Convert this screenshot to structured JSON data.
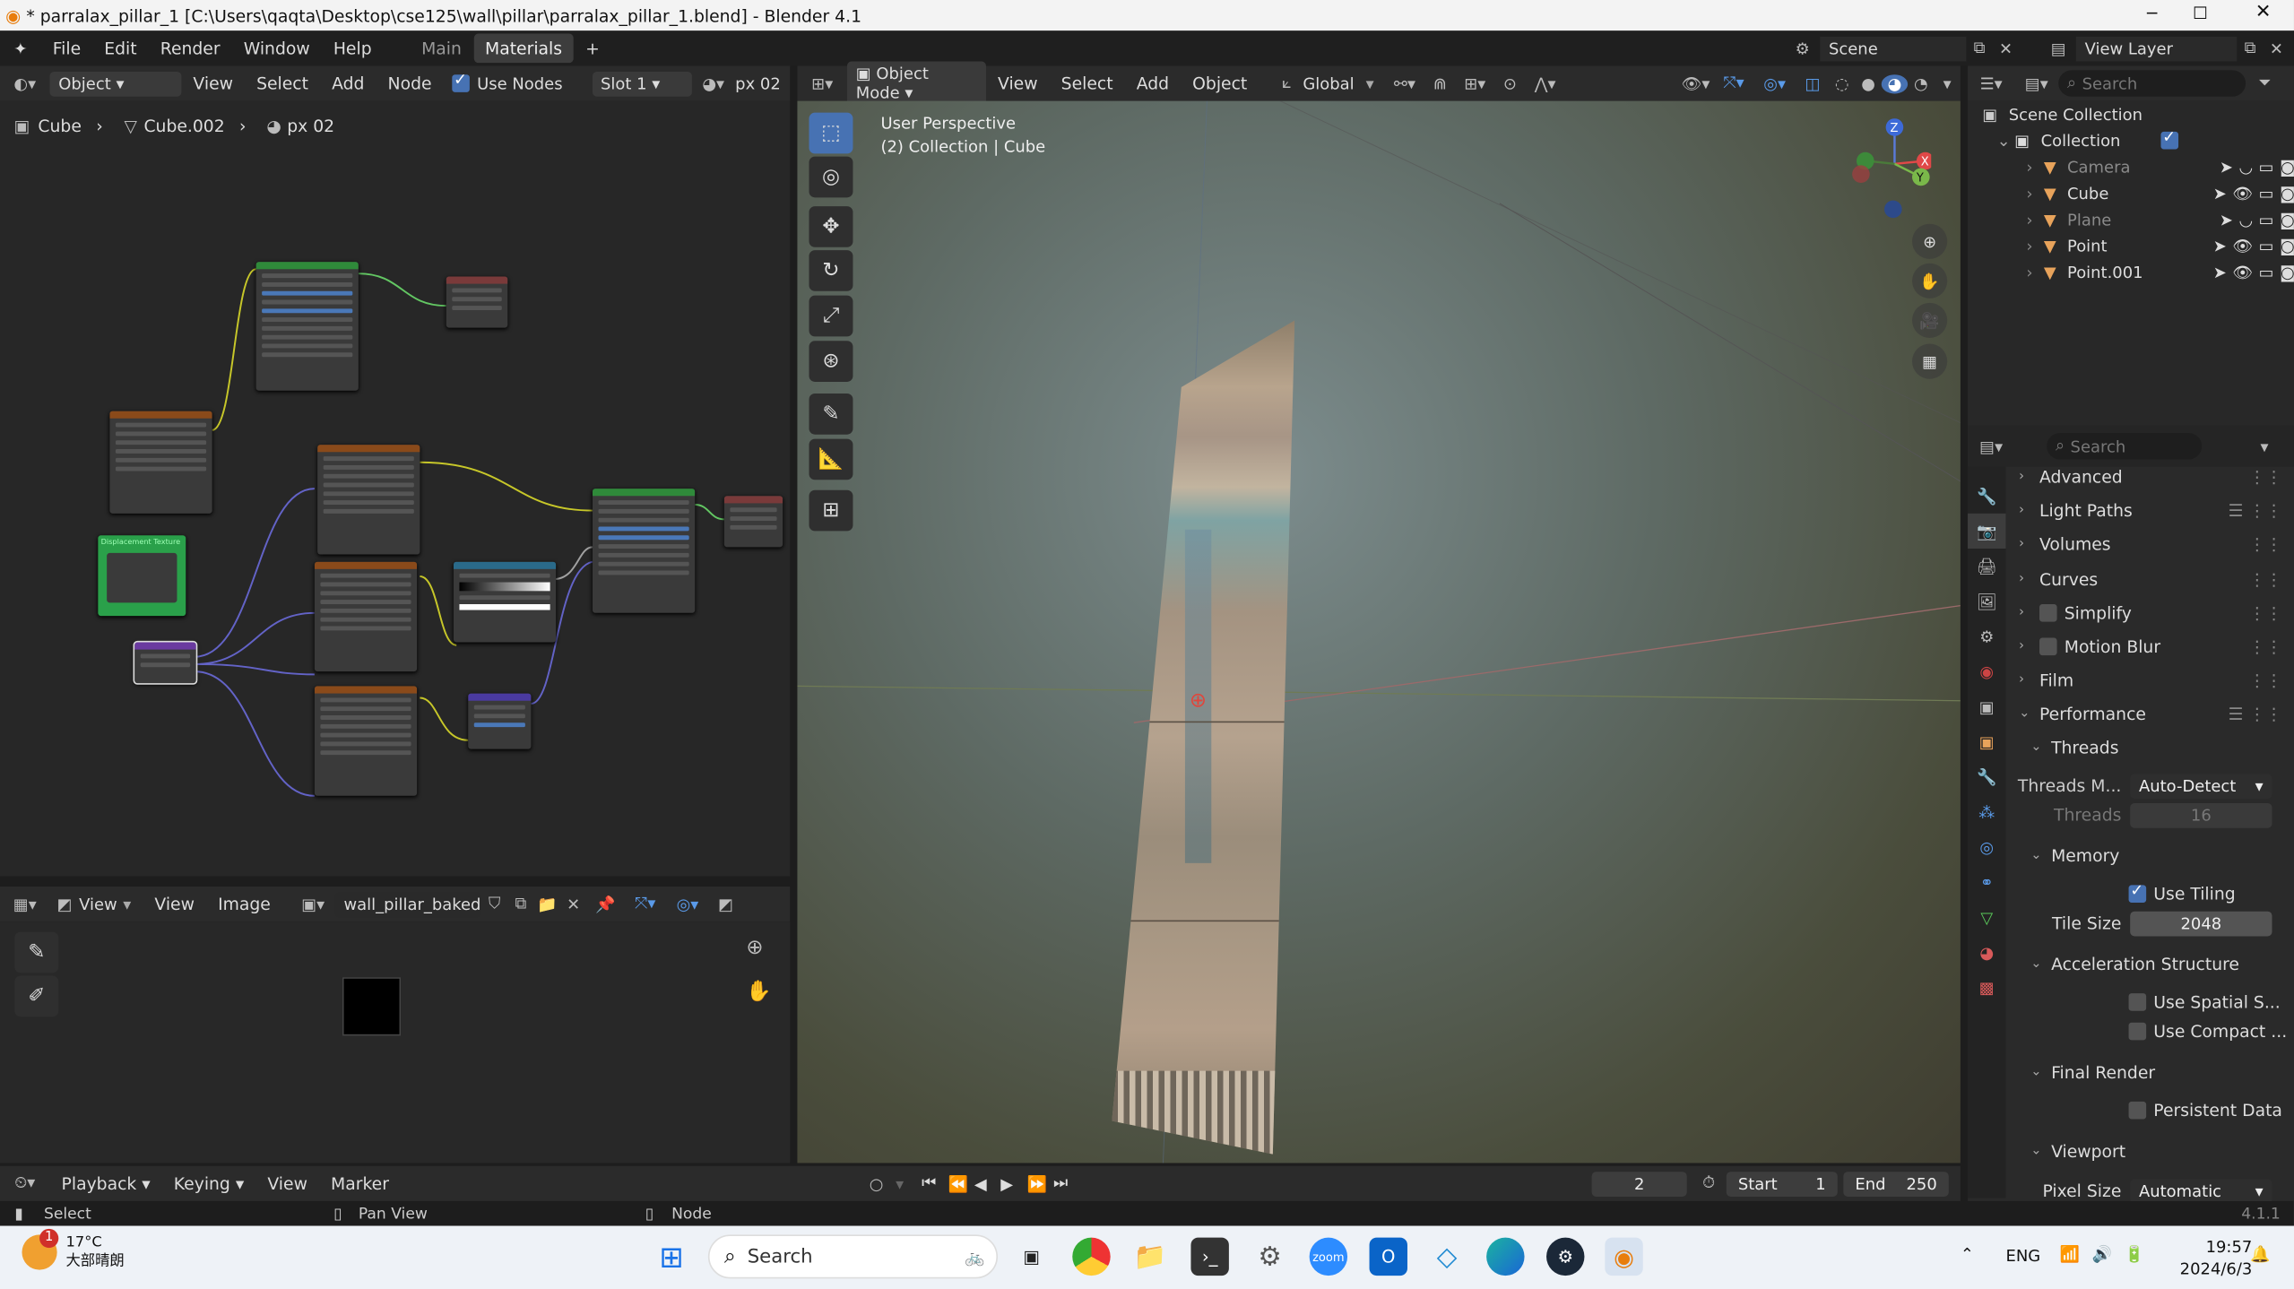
{
  "window": {
    "title": "* parralax_pillar_1 [C:\\Users\\qaqta\\Desktop\\cse125\\wall\\pillar\\parralax_pillar_1.blend] - Blender 4.1"
  },
  "menus": [
    "File",
    "Edit",
    "Render",
    "Window",
    "Help"
  ],
  "workspace_tabs": [
    "Main",
    "Materials"
  ],
  "scene": {
    "label": "Scene",
    "view_layer": "View Layer"
  },
  "node_editor": {
    "object_mode": "Object",
    "menus": [
      "View",
      "Select",
      "Add",
      "Node"
    ],
    "use_nodes": "Use Nodes",
    "slot": "Slot 1",
    "material": "px 02",
    "breadcrumb": [
      "Cube",
      "Cube.002",
      "px 02"
    ],
    "nodes": {
      "displacement_title": "Displacement Texture"
    }
  },
  "image_editor": {
    "view_mode": "View",
    "menus": [
      "View",
      "Image"
    ],
    "image_name": "wall_pillar_baked"
  },
  "viewport": {
    "mode": "Object Mode",
    "menus": [
      "View",
      "Select",
      "Add",
      "Object"
    ],
    "orientation": "Global",
    "perspective": "User Perspective",
    "collection_info": "(2) Collection | Cube",
    "gizmo": {
      "z": "Z",
      "x": "X",
      "y": "Y"
    }
  },
  "outliner": {
    "search_placeholder": "Search",
    "root": "Scene Collection",
    "collection": "Collection",
    "items": [
      {
        "name": "Camera",
        "color": "#e8a35b"
      },
      {
        "name": "Cube",
        "color": "#e8a35b"
      },
      {
        "name": "Plane",
        "color": "#e8a35b"
      },
      {
        "name": "Point",
        "color": "#e8a35b"
      },
      {
        "name": "Point.001",
        "color": "#e8a35b"
      }
    ]
  },
  "properties": {
    "search_placeholder": "Search",
    "panels": [
      "Advanced",
      "Light Paths",
      "Volumes",
      "Curves",
      "Simplify",
      "Motion Blur",
      "Film",
      "Performance"
    ],
    "threads_section": "Threads",
    "threads_mode_label": "Threads M...",
    "threads_mode_value": "Auto-Detect",
    "threads_label": "Threads",
    "threads_value": "16",
    "memory_section": "Memory",
    "use_tiling": "Use Tiling",
    "tile_size_label": "Tile Size",
    "tile_size_value": "2048",
    "accel_section": "Acceleration Structure",
    "use_spatial": "Use Spatial S...",
    "use_compact": "Use Compact ...",
    "final_render_section": "Final Render",
    "persistent_data": "Persistent Data",
    "viewport_section": "Viewport",
    "pixel_size_label": "Pixel Size",
    "pixel_size_value": "Automatic"
  },
  "timeline": {
    "menus": [
      "Playback",
      "Keying",
      "View",
      "Marker"
    ],
    "current_frame": "2",
    "start_label": "Start",
    "start": "1",
    "end_label": "End",
    "end": "250"
  },
  "statusbar": {
    "select": "Select",
    "pan": "Pan View",
    "node": "Node",
    "version": "4.1.1"
  },
  "taskbar": {
    "weather_temp": "17°C",
    "weather_desc": "大部晴朗",
    "weather_badge": "1",
    "search": "Search",
    "lang": "ENG",
    "time": "19:57",
    "date": "2024/6/3"
  }
}
